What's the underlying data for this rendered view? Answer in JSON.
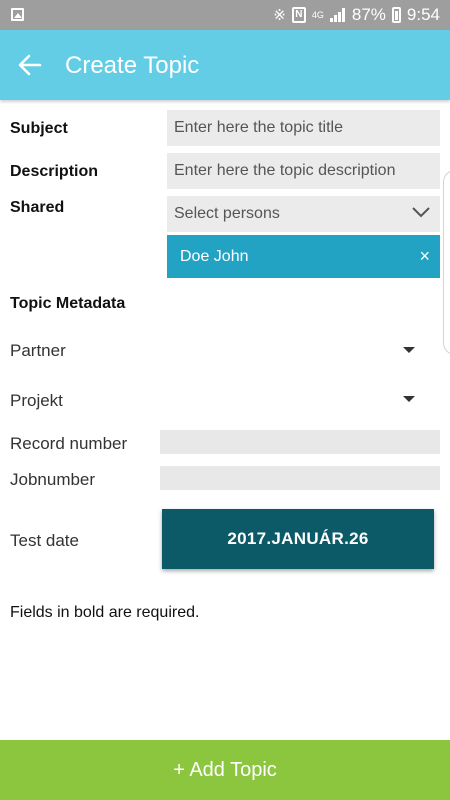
{
  "status_bar": {
    "battery": "87%",
    "time": "9:54",
    "network": "4G"
  },
  "app_bar": {
    "title": "Create Topic"
  },
  "form": {
    "subject_label": "Subject",
    "subject_placeholder": "Enter here the topic title",
    "description_label": "Description",
    "description_placeholder": "Enter here the topic description",
    "shared_label": "Shared",
    "shared_placeholder": "Select persons",
    "shared_selected": "Doe John",
    "chip_remove": "×"
  },
  "metadata": {
    "heading": "Topic Metadata",
    "partner_label": "Partner",
    "projekt_label": "Projekt",
    "record_number_label": "Record number",
    "jobnumber_label": "Jobnumber",
    "test_date_label": "Test date",
    "test_date_value": "2017.JANUÁR.26"
  },
  "footer": {
    "note": "Fields in bold are required.",
    "add_button": "+ Add Topic"
  },
  "colors": {
    "app_bar": "#63cde6",
    "chip": "#22a3c4",
    "date_button": "#0c5a68",
    "add_button": "#8cc63f"
  }
}
